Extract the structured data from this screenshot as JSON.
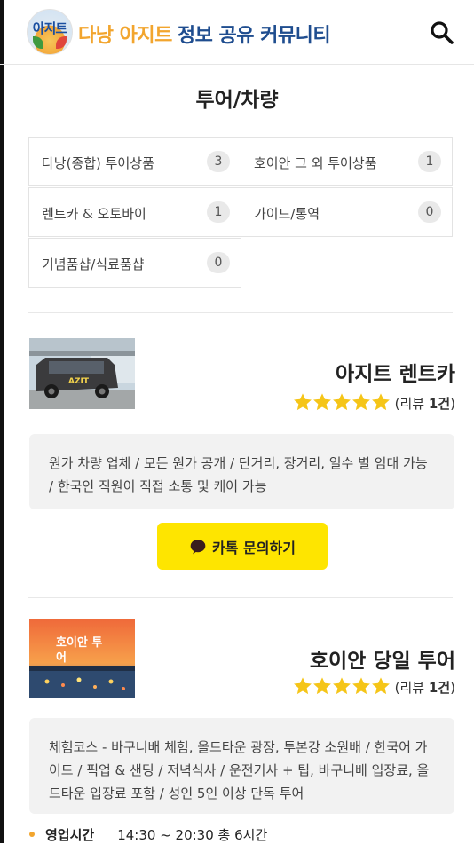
{
  "header": {
    "logo_text": "아지트",
    "brand_part1": "다낭 아지트",
    "brand_part2": "정보 공유 커뮤니티",
    "search_icon": "search-icon"
  },
  "page_title": "투어/차량",
  "categories": [
    {
      "label": "다낭(종합) 투어상품",
      "count": "3"
    },
    {
      "label": "호이안 그 외 투어상품",
      "count": "1"
    },
    {
      "label": "렌트카 & 오토바이",
      "count": "1"
    },
    {
      "label": "가이드/통역",
      "count": "0"
    },
    {
      "label": "기념품샵/식료품샵",
      "count": "0"
    }
  ],
  "listings": [
    {
      "title": "아지트 렌트카",
      "rating": 5,
      "review_prefix": "(리뷰 ",
      "review_count": "1건",
      "review_suffix": ")",
      "thumb_caption": "AZIT",
      "description": "원가 차량 업체 / 모든 원가 공개 / 단거리, 장거리, 일수 별 임대 가능 / 한국인 직원이 직접 소통 및 케어 가능",
      "cta_label": "카톡 문의하기"
    },
    {
      "title": "호이안 당일 투어",
      "rating": 5,
      "review_prefix": "(리뷰 ",
      "review_count": "1건",
      "review_suffix": ")",
      "thumb_caption": "호이안 투어",
      "description": "체험코스 - 바구니배 체험, 올드타운 광장, 투본강 소원배 / 한국어 가이드 / 픽업 & 샌딩 / 저녁식사 / 운전기사 + 팁, 바구니배 입장료, 올드타운 입장료 포함 / 성인 5인 이상 단독 투어",
      "hours_label": "영업시간",
      "hours_value": "14:30 ~ 20:30 총 6시간"
    }
  ],
  "colors": {
    "brand_orange": "#f2a52e",
    "brand_blue": "#1f4d8f",
    "star": "#f5c518",
    "kakao": "#fee500"
  }
}
